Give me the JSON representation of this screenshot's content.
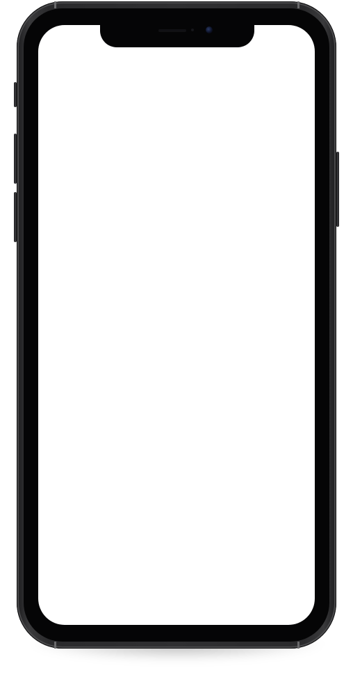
{
  "device": {
    "type": "phone-mockup",
    "frame_color": "#2f2f31",
    "bezel_color": "#050506",
    "screen_color": "#ffffff",
    "icons": [
      "front-camera-icon",
      "earpiece-speaker-icon"
    ]
  }
}
